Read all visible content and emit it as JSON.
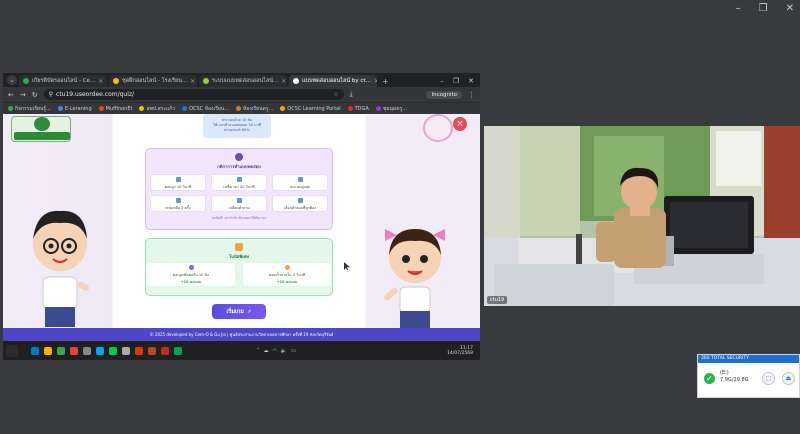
{
  "host_window": {
    "minimize": "–",
    "maximize": "❐",
    "close": "✕"
  },
  "browser": {
    "tabs": [
      {
        "label": "เกียรติบัตรออนไลน์ - Ce...",
        "color": "#34a853",
        "active": false
      },
      {
        "label": "ชุดฝึกออนไลน์ - โรงเรียน...",
        "color": "#fbbc04",
        "active": false
      },
      {
        "label": "ระบบแบบทดสอบออนไลน์...",
        "color": "#9acd32",
        "active": false
      },
      {
        "label": "แบบทดสอบออนไลน์ by ct...",
        "color": "#ffffff",
        "active": true
      }
    ],
    "new_tab": "+",
    "address": "ctu19.useordee.com/quiz/",
    "incognito_label": "Incognito",
    "bookmarks": [
      {
        "label": "กิจกรรมเรียนรู้...",
        "color": "#34a853"
      },
      {
        "label": "E-Leraning",
        "color": "#4285f4"
      },
      {
        "label": "MuffinonEt",
        "color": "#ea4335"
      },
      {
        "label": "สพป.สระแก้ว",
        "color": "#fbbc04"
      },
      {
        "label": "OCSC ห้องเรียน...",
        "color": "#1a73e8"
      },
      {
        "label": "ห้องเรียนครู...",
        "color": "#e8710a"
      },
      {
        "label": "OCSC Learning Portal",
        "color": "#f9ab00"
      },
      {
        "label": "TDGA",
        "color": "#d93025"
      },
      {
        "label": "ชุมนุมครู...",
        "color": "#9334e6"
      }
    ]
  },
  "quiz_page": {
    "info_lines": [
      "ประกอบด้วย 10 ข้อ",
      "ใช้เวลาทำแบบทดสอบ 30 นาที",
      "ผ่านเกณฑ์ 60%"
    ],
    "rules_title": "กติกาการทำแบบทดสอบ",
    "rules": [
      "ตอบถูก 10 วินาที",
      "เหลือเวลา 20 วินาที",
      "คะแนนสูงสุด",
      "ช่วยเหลือ 2 ครั้ง",
      "เปลี่ยนคำถาม",
      "เลือกคำตอบที่ถูกต้อง"
    ],
    "rules_note": "ทุกข้อมีเวลาจำกัด ต้องตอบให้ทันเวลา",
    "bonus_title": "โบนัสพิเศษ",
    "bonuses": [
      {
        "label": "ตอบถูกติดต่อกัน 10 ข้อ",
        "points": "+10 คะแนน"
      },
      {
        "label": "ตอบเร็วภายใน 5 วินาที",
        "points": "+10 คะแนน"
      }
    ],
    "start_label": "เริ่มเกม",
    "footer": "© 2025 developed by Cem-O & Gu Jio | ศูนย์ประสานงานวิทยาเขตการศึกษา ครั้งที่ 19 จังหวัดบุรีรัมย์"
  },
  "taskbar": {
    "time": "11:17",
    "date": "14/07/2568",
    "icon_colors": [
      "#0078d4",
      "#f5b400",
      "#34a853",
      "#ea4335",
      "#888888",
      "#00a4ef",
      "#06c755",
      "#aaaaaa",
      "#d83b01",
      "#b7472a",
      "#c42b1c",
      "#0f9d58"
    ]
  },
  "video": {
    "label": "ctu19"
  },
  "security_popup": {
    "title": "360 TOTAL SECURITY",
    "drive": "(E:)",
    "usage": "7.9G/29.8G",
    "open": "⬚",
    "eject": "⏏"
  }
}
